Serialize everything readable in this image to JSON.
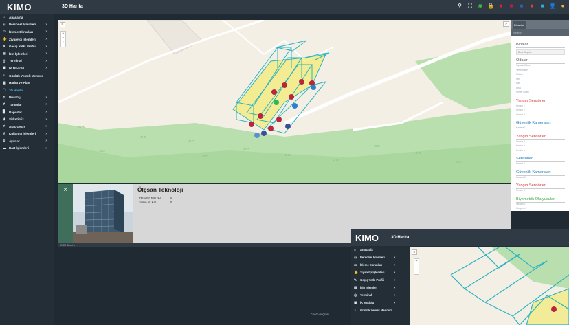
{
  "app": {
    "logo": "KIMO",
    "page_title": "3D Harita"
  },
  "topbar_icons": [
    {
      "name": "search-icon",
      "glyph": "⚲",
      "color": "#ffffff"
    },
    {
      "name": "fullscreen-icon",
      "glyph": "⛶",
      "color": "#ffffff"
    },
    {
      "name": "status-circle-icon",
      "glyph": "◉",
      "color": "#3fbf4a"
    },
    {
      "name": "lock-icon",
      "glyph": "🔒",
      "color": "#3fbf4a"
    },
    {
      "name": "flag-tr-icon",
      "glyph": "■",
      "color": "#e3202a"
    },
    {
      "name": "flag-other-icon",
      "glyph": "■",
      "color": "#c2185b"
    },
    {
      "name": "flag-en-icon",
      "glyph": "■",
      "color": "#3b5bb5"
    },
    {
      "name": "flag-de-icon",
      "glyph": "■",
      "color": "#d0463a"
    },
    {
      "name": "notification-icon",
      "glyph": "■",
      "color": "#2fb3d9"
    },
    {
      "name": "user-icon",
      "glyph": "👤",
      "color": "#ffffff"
    },
    {
      "name": "avatar-icon",
      "glyph": "●",
      "color": "#f0b43c"
    }
  ],
  "sidebar": {
    "items": [
      {
        "icon": "⌂",
        "label": "Anasayfa",
        "chevron": ""
      },
      {
        "icon": "☲",
        "label": "Personel İşlemleri",
        "chevron": "›"
      },
      {
        "icon": "▭",
        "label": "İzleme Ekranları",
        "chevron": "›"
      },
      {
        "icon": "✋",
        "label": "Ziyaretçi İşlemleri",
        "chevron": "›"
      },
      {
        "icon": "✎",
        "label": "Geçiş Yetki Profili",
        "chevron": "›"
      },
      {
        "icon": "▤",
        "label": "İzin İşlemleri",
        "chevron": "›"
      },
      {
        "icon": "◎",
        "label": "Terminal",
        "chevron": "›"
      },
      {
        "icon": "▣",
        "label": "İK Modülü",
        "chevron": "›"
      },
      {
        "icon": "♆",
        "label": "Günlük Yemek Menüsü",
        "chevron": ""
      },
      {
        "icon": "▦",
        "label": "Harita ve Plan",
        "chevron": ""
      },
      {
        "icon": "▢",
        "label": "3D Harita",
        "chevron": "",
        "active": true
      },
      {
        "icon": "⚖",
        "label": "Puantaj",
        "chevron": "›"
      },
      {
        "icon": "✐",
        "label": "Tanımlar",
        "chevron": "›"
      },
      {
        "icon": "▉",
        "label": "Raporlar",
        "chevron": "›"
      },
      {
        "icon": "♟",
        "label": "Şirketimiz",
        "chevron": "›"
      },
      {
        "icon": "⇄",
        "label": "Araç Geçiş",
        "chevron": "›"
      },
      {
        "icon": "♙",
        "label": "Kullanıcı İşlemleri",
        "chevron": "›"
      },
      {
        "icon": "⚙",
        "label": "Ayarlar",
        "chevron": "›"
      },
      {
        "icon": "▬",
        "label": "Kart İşlemleri",
        "chevron": "›"
      }
    ]
  },
  "map_controls": {
    "layers": "≡",
    "zoom_in": "+",
    "zoom_out": "−",
    "reset": "◦",
    "collapse": "»"
  },
  "right_panel": {
    "tab_label": "Dikanlar",
    "search_placeholder": "Search",
    "sections": [
      {
        "title": "Binalar",
        "style": "dark",
        "rows": [],
        "select": "Bina Seçiniz"
      },
      {
        "title": "Odalar",
        "style": "dark",
        "rows": [
          "Toplantı Odası",
          "Yemekhane",
          "Mutfak",
          "Ofis",
          "Lobi",
          "Arşiv",
          "Server Odası"
        ]
      },
      {
        "title": "Yangın Sensörleri",
        "style": "red",
        "rows": [
          "Sensör 1",
          "Sensör 2",
          "Sensör 3"
        ]
      },
      {
        "title": "Güvenlik Kameraları",
        "style": "blue",
        "rows": [
          "Kamera 1"
        ]
      },
      {
        "title": "Yangın Sensörleri",
        "style": "red",
        "rows": [
          "Sensör 4",
          "Sensör 5",
          "Sensör 6"
        ]
      },
      {
        "title": "Sensörler",
        "style": "blue",
        "rows": [
          "Sensör 7"
        ]
      },
      {
        "title": "Güvenlik Kameraları",
        "style": "blue",
        "rows": [
          "Kamera 2"
        ]
      },
      {
        "title": "Yangın Sensörleri",
        "style": "red",
        "rows": [
          "Sensör 8"
        ]
      },
      {
        "title": "Biyometrik Okuyucular",
        "style": "green",
        "rows": [
          "Okuyucu 1",
          "Okuyucu 2"
        ]
      }
    ]
  },
  "info": {
    "close": "×",
    "title": "Ölçsan Teknoloji",
    "fields": [
      {
        "label": "Personel Katı No",
        "value": "0"
      },
      {
        "label": "Zemin Alt Kat",
        "value": "0"
      }
    ]
  },
  "footer_note": "OSM Street ▾",
  "copyright": "© 2020 ÖLÇSAN",
  "overlay": {
    "logo": "KIMO",
    "page_title": "3D Harita",
    "items": [
      {
        "icon": "⌂",
        "label": "Anasayfa",
        "chevron": ""
      },
      {
        "icon": "☲",
        "label": "Personel İşlemleri",
        "chevron": "›"
      },
      {
        "icon": "▭",
        "label": "İzleme Ekranları",
        "chevron": "›"
      },
      {
        "icon": "✋",
        "label": "Ziyaretçi İşlemleri",
        "chevron": "›"
      },
      {
        "icon": "✎",
        "label": "Geçiş Yetki Profili",
        "chevron": "›"
      },
      {
        "icon": "▤",
        "label": "İzin İşlemleri",
        "chevron": "›"
      },
      {
        "icon": "◎",
        "label": "Terminal",
        "chevron": "›"
      },
      {
        "icon": "▣",
        "label": "İK Modülü",
        "chevron": "›"
      },
      {
        "icon": "♆",
        "label": "Günlük Yemek Menüsü",
        "chevron": ""
      }
    ]
  }
}
